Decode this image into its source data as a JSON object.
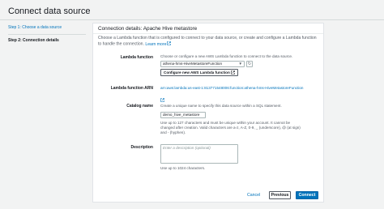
{
  "page": {
    "title": "Connect data source"
  },
  "steps": [
    {
      "label": "Step 1: Choose a data source"
    },
    {
      "label": "Step 2: Connection details"
    }
  ],
  "panel": {
    "title": "Connection details: Apache Hive metastore",
    "description": "Choose a Lambda function that is configured to connect to your data source, or create and configure a Lambda function to handle the connection.",
    "learn_more": "Learn more"
  },
  "lambda": {
    "label": "Lambda function",
    "hint": "Choose or configure a new AWS Lambda function to connect to the data source.",
    "selected": "athena-hms-HiveMetastoreFunction",
    "configure_button": "Configure new AWS Lambda function"
  },
  "arn": {
    "label": "Lambda function ARN",
    "value": "arn:aws:lambda:us-east-1:813771548006:function:athena-hms-HiveMetastoreFunction"
  },
  "catalog": {
    "label": "Catalog name",
    "hint": "Create a unique name to specify this data source within a SQL statement.",
    "value": "demo_hive_metastore",
    "constraints": "Use up to 127 characters and must be unique within your account. It cannot be changed after creation. Valid characters are a-z, A-Z, 0-9, _ (underscore), @ (at sign) and - (hyphen)."
  },
  "description": {
    "label": "Description",
    "placeholder": "Enter a description (optional)",
    "hint": "Use up to 1024 characters."
  },
  "footer": {
    "cancel": "Cancel",
    "previous": "Previous",
    "connect": "Connect"
  },
  "colors": {
    "link": "#0073bb",
    "primary_button": "#0073bb",
    "background": "#f2f3f3"
  }
}
